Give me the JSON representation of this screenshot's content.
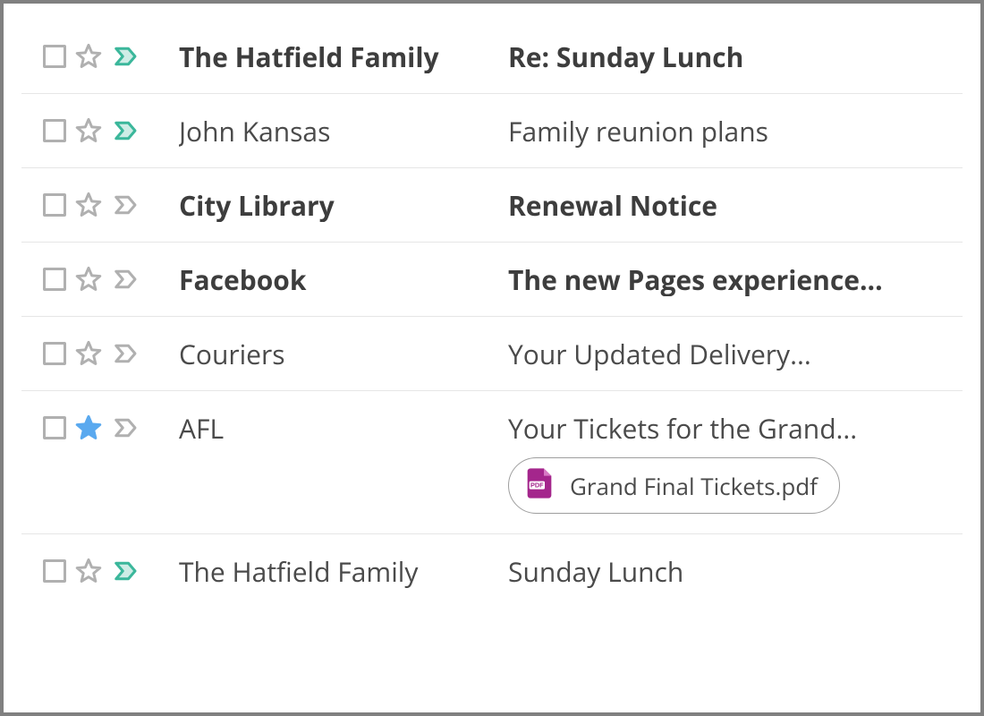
{
  "colors": {
    "star_outline": "#b0b0b0",
    "star_fill": "#5aa9ef",
    "important_on": "#3bb79b",
    "important_off": "#b0b0b0",
    "pdf": "#a4268c"
  },
  "messages": [
    {
      "sender": "The Hatfield Family",
      "subject": "Re: Sunday Lunch",
      "unread": true,
      "starred": false,
      "important": true,
      "attachment": null
    },
    {
      "sender": "John Kansas",
      "subject": "Family reunion plans",
      "unread": false,
      "starred": false,
      "important": true,
      "attachment": null
    },
    {
      "sender": "City Library",
      "subject": "Renewal Notice",
      "unread": true,
      "starred": false,
      "important": false,
      "attachment": null
    },
    {
      "sender": "Facebook",
      "subject": "The new Pages experience...",
      "unread": true,
      "starred": false,
      "important": false,
      "attachment": null
    },
    {
      "sender": "Couriers",
      "subject": "Your Updated Delivery...",
      "unread": false,
      "starred": false,
      "important": false,
      "attachment": null
    },
    {
      "sender": "AFL",
      "subject": "Your Tickets for the Grand...",
      "unread": false,
      "starred": true,
      "important": false,
      "attachment": {
        "name": "Grand Final Tickets.pdf",
        "type": "pdf"
      }
    },
    {
      "sender": "The Hatfield Family",
      "subject": "Sunday Lunch",
      "unread": false,
      "starred": false,
      "important": true,
      "attachment": null
    }
  ]
}
